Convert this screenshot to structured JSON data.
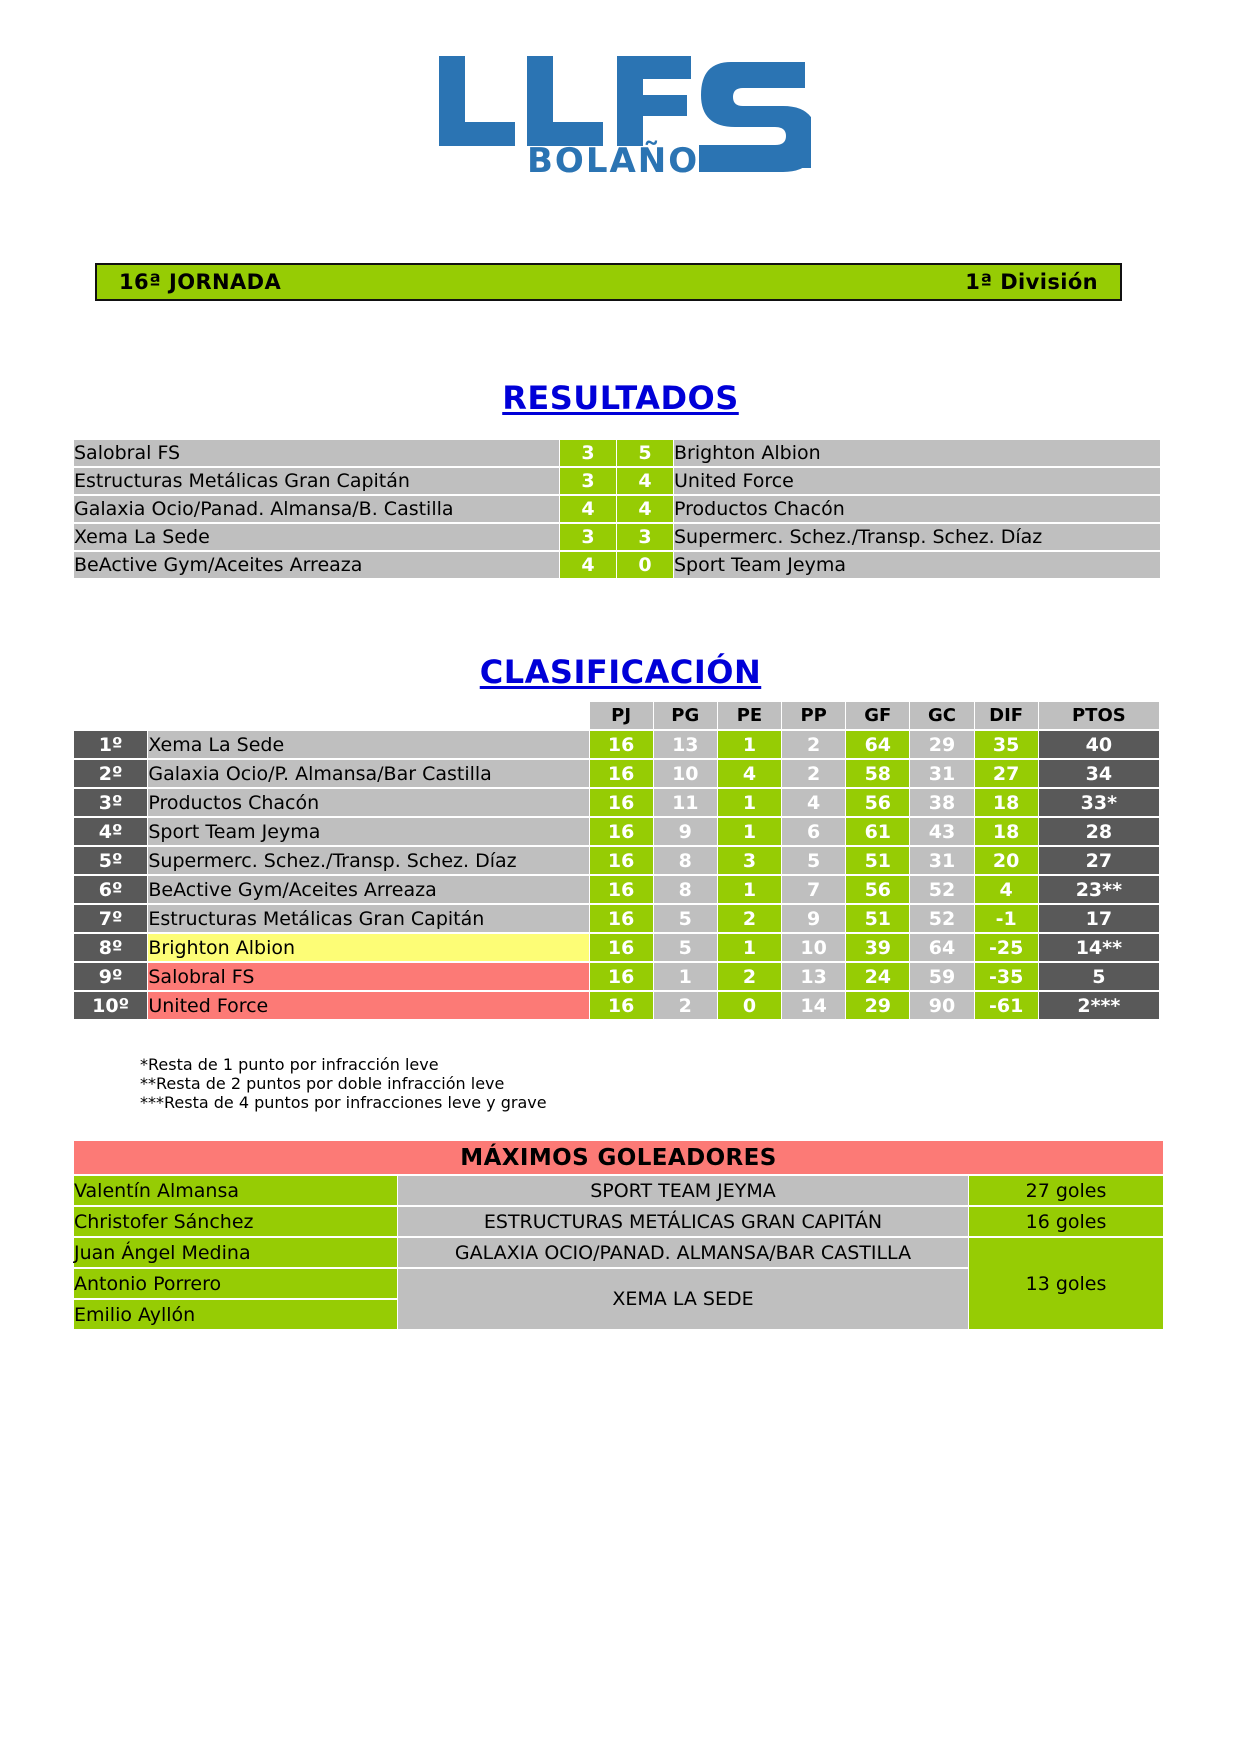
{
  "logo": {
    "main_text": "LLFS",
    "sub_text": "BOLAÑO",
    "color": "#2b74b3"
  },
  "header": {
    "jornada": "16ª JORNADA",
    "division": "1ª División",
    "bar_color": "#96cc04"
  },
  "resultados": {
    "title": "RESULTADOS",
    "matches": [
      {
        "home": "Salobral FS",
        "home_score": "3",
        "away_score": "5",
        "away": "Brighton Albion"
      },
      {
        "home": "Estructuras Metálicas Gran Capitán",
        "home_score": "3",
        "away_score": "4",
        "away": "United Force"
      },
      {
        "home": "Galaxia Ocio/Panad. Almansa/B. Castilla",
        "home_score": "4",
        "away_score": "4",
        "away": "Productos Chacón"
      },
      {
        "home": "Xema La Sede",
        "home_score": "3",
        "away_score": "3",
        "away": "Supermerc. Schez./Transp. Schez. Díaz"
      },
      {
        "home": "BeActive Gym/Aceites Arreaza",
        "home_score": "4",
        "away_score": "0",
        "away": "Sport Team Jeyma"
      }
    ]
  },
  "clasificacion": {
    "title": "CLASIFICACIÓN",
    "columns": [
      "PJ",
      "PG",
      "PE",
      "PP",
      "GF",
      "GC",
      "DIF",
      "PTOS"
    ],
    "rows": [
      {
        "pos": "1º",
        "team": "Xema La Sede",
        "pj": "16",
        "pg": "13",
        "pe": "1",
        "pp": "2",
        "gf": "64",
        "gc": "29",
        "dif": "35",
        "ptos": "40",
        "highlight": "none"
      },
      {
        "pos": "2º",
        "team": "Galaxia Ocio/P. Almansa/Bar Castilla",
        "pj": "16",
        "pg": "10",
        "pe": "4",
        "pp": "2",
        "gf": "58",
        "gc": "31",
        "dif": "27",
        "ptos": "34",
        "highlight": "none"
      },
      {
        "pos": "3º",
        "team": "Productos Chacón",
        "pj": "16",
        "pg": "11",
        "pe": "1",
        "pp": "4",
        "gf": "56",
        "gc": "38",
        "dif": "18",
        "ptos": "33*",
        "highlight": "none"
      },
      {
        "pos": "4º",
        "team": "Sport Team Jeyma",
        "pj": "16",
        "pg": "9",
        "pe": "1",
        "pp": "6",
        "gf": "61",
        "gc": "43",
        "dif": "18",
        "ptos": "28",
        "highlight": "none"
      },
      {
        "pos": "5º",
        "team": "Supermerc. Schez./Transp. Schez. Díaz",
        "pj": "16",
        "pg": "8",
        "pe": "3",
        "pp": "5",
        "gf": "51",
        "gc": "31",
        "dif": "20",
        "ptos": "27",
        "highlight": "none"
      },
      {
        "pos": "6º",
        "team": "BeActive Gym/Aceites Arreaza",
        "pj": "16",
        "pg": "8",
        "pe": "1",
        "pp": "7",
        "gf": "56",
        "gc": "52",
        "dif": "4",
        "ptos": "23**",
        "highlight": "none"
      },
      {
        "pos": "7º",
        "team": "Estructuras Metálicas Gran Capitán",
        "pj": "16",
        "pg": "5",
        "pe": "2",
        "pp": "9",
        "gf": "51",
        "gc": "52",
        "dif": "-1",
        "ptos": "17",
        "highlight": "none"
      },
      {
        "pos": "8º",
        "team": "Brighton Albion",
        "pj": "16",
        "pg": "5",
        "pe": "1",
        "pp": "10",
        "gf": "39",
        "gc": "64",
        "dif": "-25",
        "ptos": "14**",
        "highlight": "yellow"
      },
      {
        "pos": "9º",
        "team": "Salobral FS",
        "pj": "16",
        "pg": "1",
        "pe": "2",
        "pp": "13",
        "gf": "24",
        "gc": "59",
        "dif": "-35",
        "ptos": "5",
        "highlight": "red"
      },
      {
        "pos": "10º",
        "team": "United Force",
        "pj": "16",
        "pg": "2",
        "pe": "0",
        "pp": "14",
        "gf": "29",
        "gc": "90",
        "dif": "-61",
        "ptos": "2***",
        "highlight": "red"
      }
    ],
    "footnotes": [
      "*Resta de 1 punto por infracción leve",
      "**Resta de 2 puntos por doble infracción leve",
      "***Resta de 4 puntos por infracciones leve y grave"
    ]
  },
  "goleadores": {
    "title": "MÁXIMOS GOLEADORES",
    "entries": [
      {
        "player": "Valentín Almansa",
        "team": "SPORT TEAM JEYMA",
        "goals": "27 goles"
      },
      {
        "player": "Christofer Sánchez",
        "team": "ESTRUCTURAS METÁLICAS GRAN CAPITÁN",
        "goals": "16 goles"
      },
      {
        "player": "Juan Ángel Medina",
        "team": "GALAXIA OCIO/PANAD. ALMANSA/BAR CASTILLA",
        "goals": "13 goles"
      },
      {
        "player": "Antonio Porrero",
        "team": "XEMA LA SEDE",
        "goals": ""
      },
      {
        "player": "Emilio Ayllón",
        "team": "",
        "goals": ""
      }
    ]
  },
  "colors": {
    "green": "#96cc04",
    "grey": "#bfbfbf",
    "dark_grey": "#595959",
    "yellow": "#fdfd76",
    "red": "#fc7a76",
    "blue_title": "#0000d8",
    "logo_blue": "#2b74b3"
  }
}
